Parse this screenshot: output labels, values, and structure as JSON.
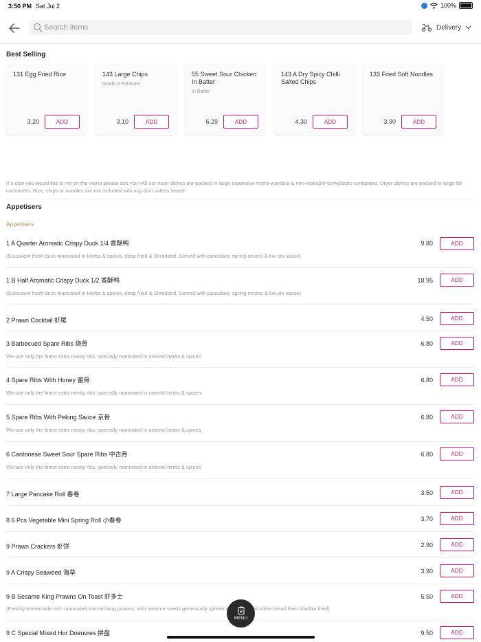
{
  "status_bar": {
    "time": "3:50 PM",
    "date": "Sat Jul 2",
    "battery": "100%"
  },
  "header": {
    "search_placeholder": "Search items",
    "delivery_label": "Delivery"
  },
  "best_selling": {
    "title": "Best Selling",
    "items": [
      {
        "name": "131 Egg Fried Rice",
        "sub": "",
        "price": "3.20",
        "add": "ADD"
      },
      {
        "name": "143 Large Chips",
        "sub": "Grade A Potatoes",
        "price": "3.10",
        "add": "ADD"
      },
      {
        "name": "55 Sweet Sour Chicken In Batter",
        "sub": "In Batter",
        "price": "6.29",
        "add": "ADD"
      },
      {
        "name": "143 A Dry Spicy Chilli Salted Chips",
        "sub": "",
        "price": "4.30",
        "add": "ADD"
      },
      {
        "name": "133 Fried Soft Noodles",
        "sub": "",
        "price": "3.90",
        "add": "ADD"
      }
    ]
  },
  "info_text": "If a dish you would like is not on the menu please ask.<br/>All our main dishes are packed in large expensive micro-wavable & non-leakable<br/>plastic containers. Dryer dishes are packed in large foil containers. Rice, chips or noodles are not included with any dish unless stated.",
  "appetisers": {
    "title": "Appetisers",
    "subcategory": "Appetisers",
    "items": [
      {
        "name": "1 A Quarter Aromatic Crispy Duck 1/4 香酥鸭",
        "desc": "(Succulent fresh duck marinated in Herbs & spices, deep fried & Shredded. Served with pancakes, spring onions & hoi sin sauce)",
        "price": "9.80",
        "add": "ADD"
      },
      {
        "name": "1 B Half Aromatic Crispy Duck 1/2 香酥鸭",
        "desc": "(Succulent fresh duck marinated in Herbs & spices, deep fried & Shredded. Served with pancakes, spring onions & hoi sin sauce)",
        "price": "18.95",
        "add": "ADD"
      },
      {
        "name": "2 Prawn Cocktail 虾尾",
        "desc": "",
        "price": "4.50",
        "add": "ADD"
      },
      {
        "name": "3 Barbecued Spare Ribs 烧骨",
        "desc": "We use only the finest extra meaty ribs, specially marinated in oriental herbs & spices",
        "price": "6.80",
        "add": "ADD"
      },
      {
        "name": "4 Spare Ribs With Honey 蜜骨",
        "desc": "We use only the finest extra meaty ribs, specially marinated in oriental herbs & spices",
        "price": "6.80",
        "add": "ADD"
      },
      {
        "name": "5 Spare Ribs With Peking Sauce 京骨",
        "desc": "We use only the finest extra meaty ribs, specially marinated in oriental herbs & spices",
        "price": "6.80",
        "add": "ADD"
      },
      {
        "name": "6 Cantonese Sweet Sour Spare Ribs 中古骨",
        "desc": "We use only the finest extra meaty ribs, specially marinated in oriental herbs & spices",
        "price": "6.80",
        "add": "ADD"
      },
      {
        "name": "7 Large Pancake Roll 春卷",
        "desc": "",
        "price": "3.50",
        "add": "ADD"
      },
      {
        "name": "8 6 Pcs Vegetable Mini Spring Roll 小春卷",
        "desc": "",
        "price": "3.70",
        "add": "ADD"
      },
      {
        "name": "9 Prawn Crackers 虾饼",
        "desc": "",
        "price": "2.90",
        "add": "ADD"
      },
      {
        "name": "9 A Crispy Seaweed 海草",
        "desc": "",
        "price": "3.90",
        "add": "ADD"
      },
      {
        "name": "9 B Sesame King Prawns On Toast 虾多士",
        "desc": "(Freshly homemade with marinated minced king prawns, with sesame seeds generously spread on thick sliced white bread then shallow fried)",
        "price": "5.50",
        "add": "ADD"
      },
      {
        "name": "9 C Special Mixed Hor Doeuvres 拼盘",
        "desc": "",
        "price": "9.50",
        "add": "ADD"
      }
    ]
  },
  "menu_button": {
    "label": "MENU"
  },
  "colors": {
    "accent": "#c2187c",
    "subcategory": "#b89560"
  }
}
